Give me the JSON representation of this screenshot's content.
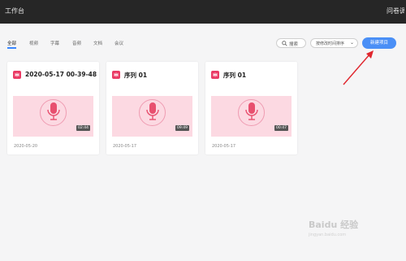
{
  "app": {
    "title": "工作台",
    "right_label": "问卷调查"
  },
  "tabs": [
    {
      "label": "全部",
      "active": true
    },
    {
      "label": "视频",
      "active": false
    },
    {
      "label": "字幕",
      "active": false
    },
    {
      "label": "音频",
      "active": false
    },
    {
      "label": "文档",
      "active": false
    },
    {
      "label": "会议",
      "active": false
    }
  ],
  "toolbar": {
    "search_label": "搜索",
    "sort_label": "按修改时间排序",
    "new_project_label": "新建项目"
  },
  "cards": [
    {
      "title": "2020-05-17 00-39-48",
      "duration": "02:44",
      "date": "2020-05-20",
      "icon": "waveform-icon"
    },
    {
      "title": "序列 01",
      "duration": "09:49",
      "date": "2020-05-17",
      "icon": "waveform-icon"
    },
    {
      "title": "序列 01",
      "duration": "00:47",
      "date": "2020-05-17",
      "icon": "waveform-icon"
    }
  ],
  "watermark": {
    "text": "Baidu 经验",
    "sub": "jingyan.baidu.com"
  },
  "colors": {
    "accent": "#4a8ff6",
    "badge": "#ea3a64",
    "thumb_bg": "#fcd9e2",
    "annotation": "#e0262e"
  }
}
